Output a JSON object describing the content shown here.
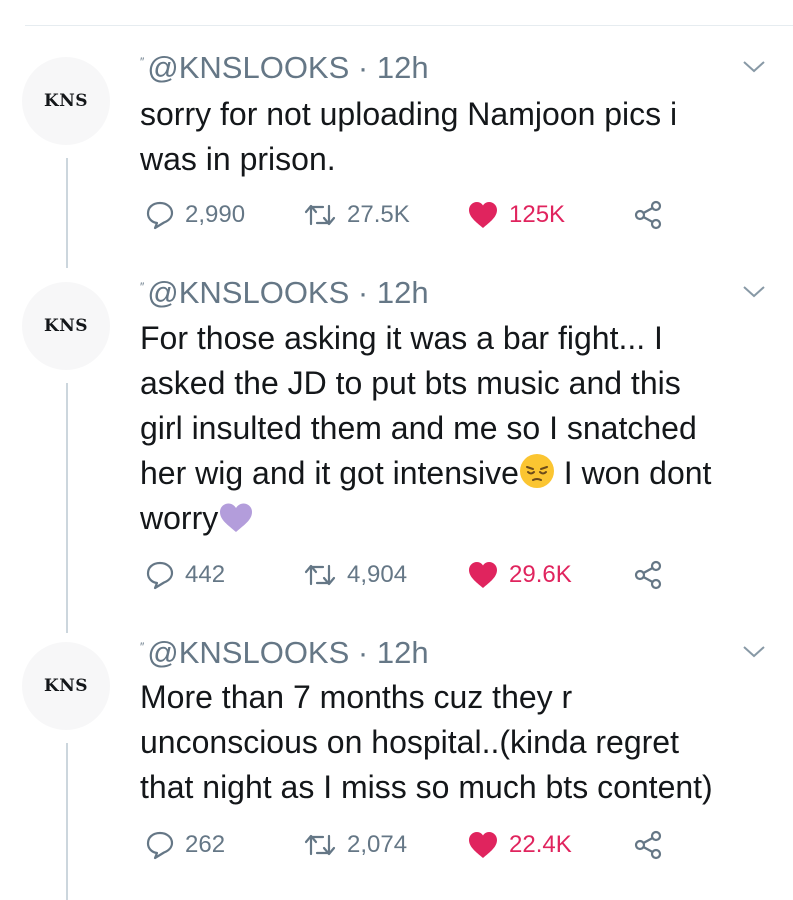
{
  "tweets": [
    {
      "avatar": "KNS",
      "mark": "″",
      "handle": "@KNSLOOKS",
      "sep": "·",
      "time": "12h",
      "lines": [
        "sorry for not uploading Namjoon pics i",
        "was in prison."
      ],
      "reply_count": "2,990",
      "retweet_count": "27.5K",
      "like_count": "125K"
    },
    {
      "avatar": "KNS",
      "mark": "″",
      "handle": "@KNSLOOKS",
      "sep": "·",
      "time": "12h",
      "lines": [
        "For those asking it was a bar fight... I",
        "asked the JD to put bts music and this",
        "girl insulted them and me so I snatched",
        "her wig and it got intensive",
        "I won dont",
        "worry"
      ],
      "reply_count": "442",
      "retweet_count": "4,904",
      "like_count": "29.6K"
    },
    {
      "avatar": "KNS",
      "mark": "″",
      "handle": "@KNSLOOKS",
      "sep": "·",
      "time": "12h",
      "lines": [
        "More than 7 months cuz they r",
        "unconscious on hospital..(kinda regret",
        "that night as I miss so much bts content)"
      ],
      "reply_count": "262",
      "retweet_count": "2,074",
      "like_count": "22.4K"
    }
  ],
  "icons": {
    "reply": "reply-icon",
    "retweet": "retweet-icon",
    "like": "heart-filled-icon",
    "share": "share-icon",
    "menu": "chevron-down-icon",
    "pensive": "pensive-face-emoji",
    "heart_purple": "purple-heart-emoji"
  },
  "colors": {
    "like": "#e0245e",
    "secondary_text": "#657786",
    "thread_line": "#ccd6dd",
    "purple_heart": "#b39ddb",
    "emoji_face": "#fbc531"
  }
}
